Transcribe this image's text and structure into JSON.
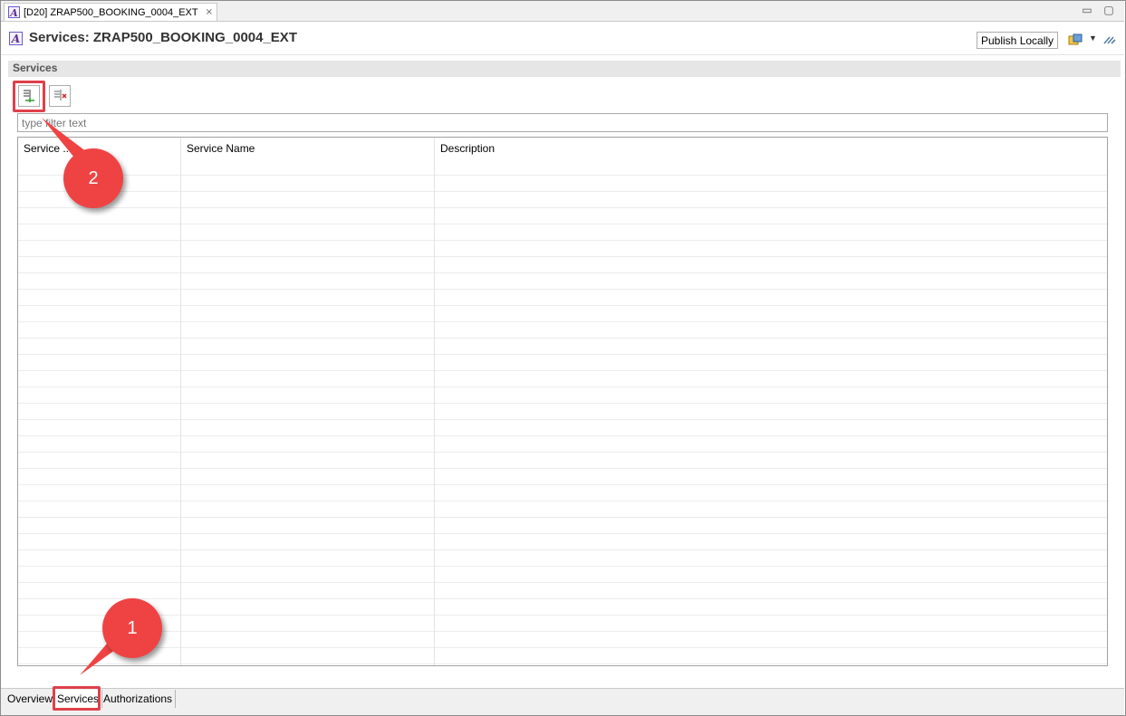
{
  "editor_tab": {
    "label": "[D20] ZRAP500_BOOKING_0004_EXT",
    "close": "⨯",
    "icon": "abap-object-icon"
  },
  "window_controls": {
    "minimize": "▭",
    "maximize": "▢"
  },
  "header": {
    "title": "Services: ZRAP500_BOOKING_0004_EXT",
    "publish_label": "Publish Locally"
  },
  "section": {
    "title": "Services"
  },
  "filter": {
    "placeholder": "type filter text",
    "value": ""
  },
  "table": {
    "columns": [
      "Service ...",
      "Service Name",
      "Description"
    ],
    "rows": []
  },
  "bottom_tabs": [
    {
      "label": "Overview",
      "active": false
    },
    {
      "label": "Services",
      "active": true
    },
    {
      "label": "Authorizations",
      "active": false
    }
  ],
  "callouts": {
    "one": "1",
    "two": "2"
  },
  "colors": {
    "callout": "#ef4343",
    "highlight": "#e0404a"
  }
}
